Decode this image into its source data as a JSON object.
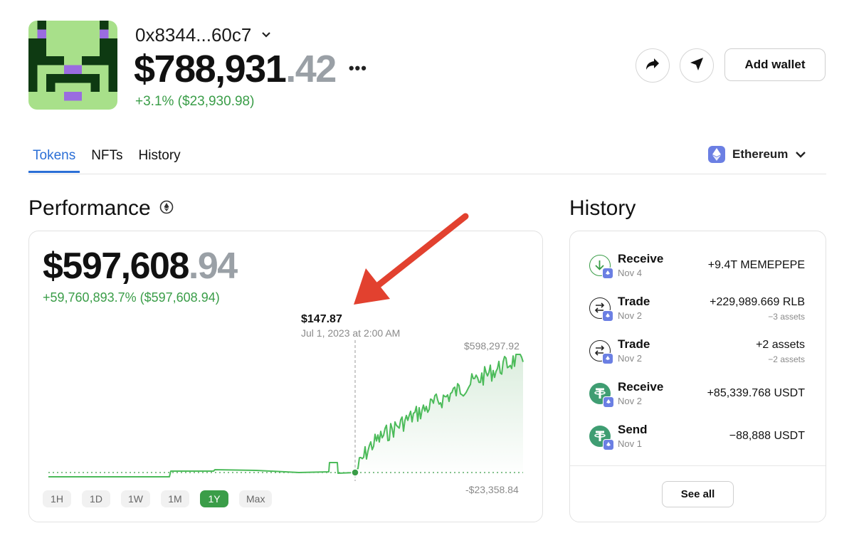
{
  "wallet": {
    "address": "0x8344...60c7",
    "balance_main": "$788,931",
    "balance_cents": ".42",
    "more": "•••",
    "change": "+3.1% ($23,930.98)"
  },
  "actions": {
    "share_icon": "share-arrow-icon",
    "send_icon": "send-arrow-icon",
    "add_wallet_label": "Add wallet"
  },
  "tabs": [
    {
      "label": "Tokens",
      "active": true
    },
    {
      "label": "NFTs",
      "active": false
    },
    {
      "label": "History",
      "active": false
    }
  ],
  "network": {
    "label": "Ethereum",
    "icon": "ethereum-icon"
  },
  "performance": {
    "title": "Performance",
    "value_main": "$597,608",
    "value_cents": ".94",
    "change": "+59,760,893.7% ($597,608.94)",
    "tooltip_value": "$147.87",
    "tooltip_date": "Jul 1, 2023 at 2:00 AM",
    "max_label": "$598,297.92",
    "min_label": "-$23,358.84",
    "ranges": [
      {
        "label": "1H",
        "active": false
      },
      {
        "label": "1D",
        "active": false
      },
      {
        "label": "1W",
        "active": false
      },
      {
        "label": "1M",
        "active": false
      },
      {
        "label": "1Y",
        "active": true
      },
      {
        "label": "Max",
        "active": false
      }
    ]
  },
  "history": {
    "title": "History",
    "items": [
      {
        "type": "Receive",
        "date": "Nov 4",
        "amount": "+9.4T MEMEPEPE",
        "sub": "",
        "icon": "receive-arrow-icon"
      },
      {
        "type": "Trade",
        "date": "Nov 2",
        "amount": "+229,989.669 RLB",
        "sub": "−3 assets",
        "icon": "trade-swap-icon"
      },
      {
        "type": "Trade",
        "date": "Nov 2",
        "amount": "+2 assets",
        "sub": "−2 assets",
        "icon": "trade-swap-icon"
      },
      {
        "type": "Receive",
        "date": "Nov 2",
        "amount": "+85,339.768 USDT",
        "sub": "",
        "icon": "tether-icon"
      },
      {
        "type": "Send",
        "date": "Nov 1",
        "amount": "−88,888 USDT",
        "sub": "",
        "icon": "tether-icon"
      }
    ],
    "see_all": "See all"
  },
  "colors": {
    "accent_blue": "#2b6fd6",
    "positive_green": "#3a9d48",
    "annotation_red": "#e2412f",
    "avatar_green": "#a8e08a",
    "avatar_dark": "#0e3a12",
    "avatar_purple": "#9a6ce0"
  }
}
